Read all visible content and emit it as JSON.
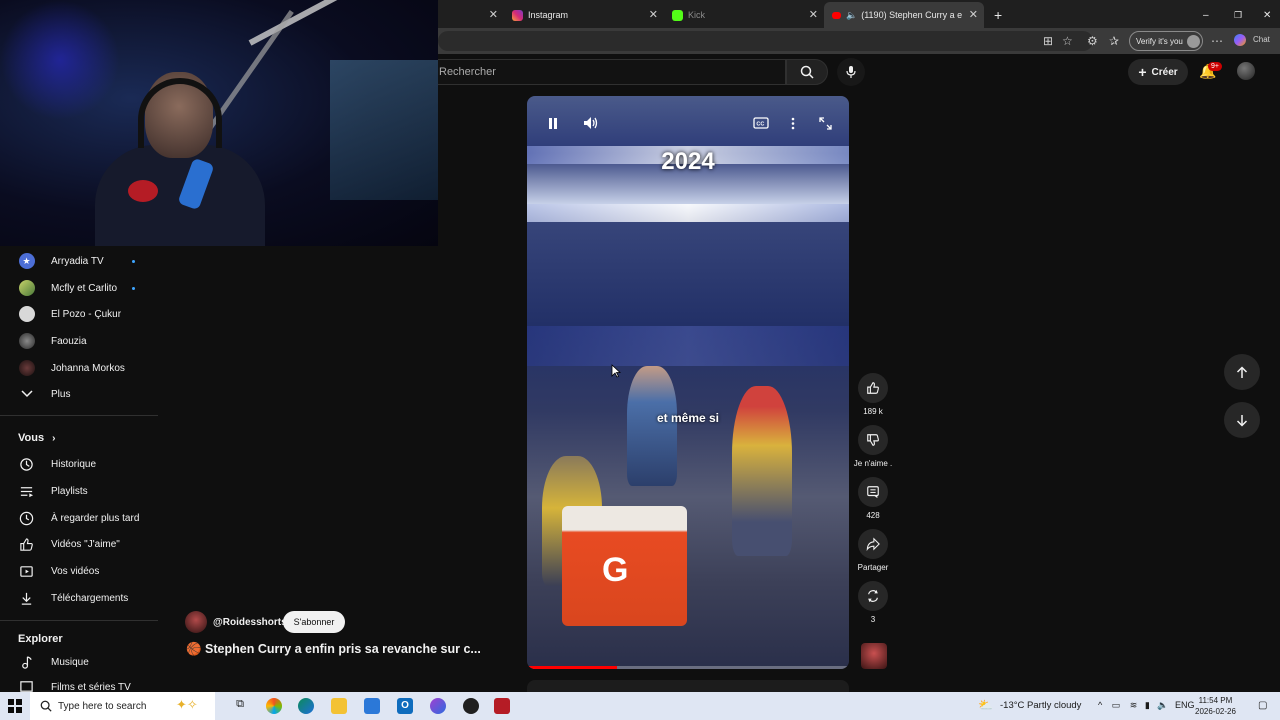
{
  "browser": {
    "tabs": [
      {
        "label": "Instagram"
      },
      {
        "label": "Kick"
      },
      {
        "label": "(1190) Stephen Curry a e"
      }
    ],
    "verify_label": "Verify it's you",
    "chat_label": "Chat"
  },
  "header": {
    "search_placeholder": "Rechercher",
    "create_label": "Créer",
    "notif_badge": "9+"
  },
  "sidebar": {
    "subscriptions": [
      {
        "name": "Arryadia TV",
        "live": true
      },
      {
        "name": "Mcfly et Carlito",
        "live": true
      },
      {
        "name": "El Pozo - Çukur",
        "live": false
      },
      {
        "name": "Faouzia",
        "live": false
      },
      {
        "name": "Johanna Morkos",
        "live": false
      }
    ],
    "more_label": "Plus",
    "you_heading": "Vous",
    "you_items": [
      {
        "label": "Historique",
        "icon": "history-icon"
      },
      {
        "label": "Playlists",
        "icon": "playlist-icon"
      },
      {
        "label": "À regarder plus tard",
        "icon": "clock-icon"
      },
      {
        "label": "Vidéos \"J'aime\"",
        "icon": "thumbs-up-icon"
      },
      {
        "label": "Vos vidéos",
        "icon": "play-square-icon"
      },
      {
        "label": "Téléchargements",
        "icon": "download-icon"
      }
    ],
    "explore_heading": "Explorer",
    "explore_items": [
      {
        "label": "Musique",
        "icon": "music-icon"
      },
      {
        "label": "Films et séries TV",
        "icon": "film-icon"
      }
    ]
  },
  "video": {
    "overlay_year": "2024",
    "subtitle": "et même si",
    "progress_fraction": 0.28
  },
  "actions": {
    "likes": "189 k",
    "dislike_label": "Je n'aime .",
    "comments": "428",
    "share_label": "Partager",
    "remix_count": "3"
  },
  "short_info": {
    "channel": "@Roidesshorts",
    "subscribe_label": "S'abonner",
    "title": "🏀 Stephen Curry a enfin pris sa revanche sur c..."
  },
  "taskbar": {
    "search_placeholder": "Type here to search",
    "weather": "-13°C  Partly cloudy",
    "language": "ENG",
    "time": "11:54 PM",
    "date": "2026-02-26"
  },
  "colors": {
    "background": "#0f0f0f",
    "live_dot": "#3ea6ff",
    "progress": "#ff0000",
    "badge": "#cc0000"
  }
}
